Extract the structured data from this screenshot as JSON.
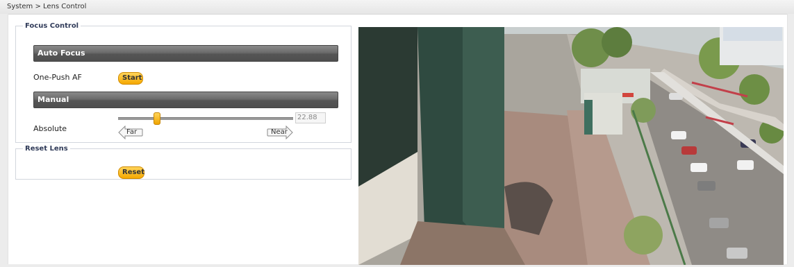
{
  "breadcrumb": "System > Lens Control",
  "focus_control": {
    "legend": "Focus Control",
    "auto_focus": {
      "title": "Auto Focus",
      "one_push_label": "One-Push AF",
      "start_button": "Start"
    },
    "manual": {
      "title": "Manual",
      "absolute_label": "Absolute",
      "value": "22.88",
      "slider_fraction": 0.22,
      "far_button": "Far",
      "near_button": "Near"
    }
  },
  "reset_lens": {
    "legend": "Reset Lens",
    "reset_button": "Reset"
  },
  "colors": {
    "accent_button": "#f5a800",
    "section_bar": "#5a5a5a",
    "legend_text": "#2f3a58"
  },
  "icons": {
    "far": "left-arrow-icon",
    "near": "right-arrow-icon"
  }
}
